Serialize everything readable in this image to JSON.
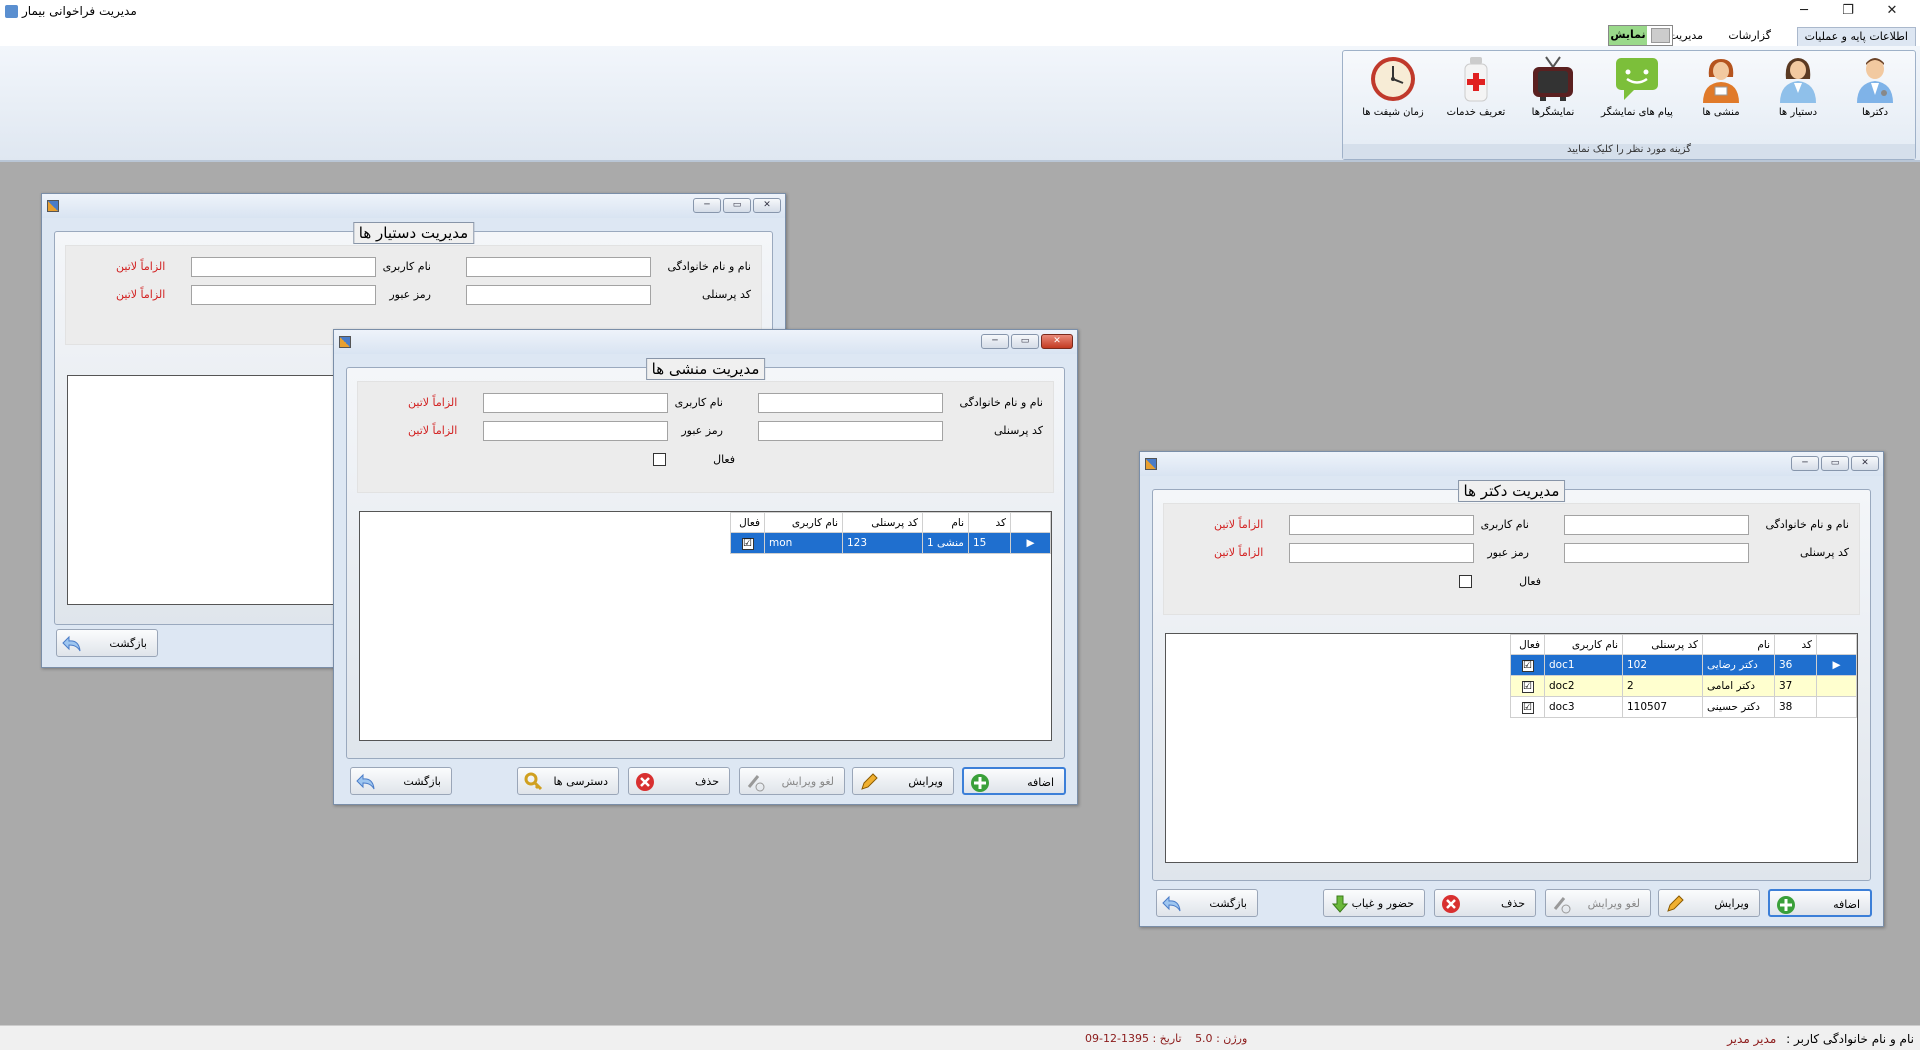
{
  "window": {
    "title": "مدیریت فراخوانی بیمار",
    "minimize": "─",
    "maximize": "❐",
    "close": "✕"
  },
  "menu": {
    "tabs": [
      "اطلاعات پایه و عملیات",
      "گزارشات",
      "مدیریت"
    ],
    "display_toggle": "نمایش"
  },
  "ribbon": {
    "caption": "گزینه مورد نظر را کلیک نمایید",
    "items": [
      {
        "label": "دکترها",
        "icon": "doctor-icon"
      },
      {
        "label": "دستیار ها",
        "icon": "assistant-icon"
      },
      {
        "label": "منشی ها",
        "icon": "secretary-icon"
      },
      {
        "label": "پیام های نمایشگر",
        "icon": "message-icon"
      },
      {
        "label": "نمایشگرها",
        "icon": "tv-icon"
      },
      {
        "label": "تعریف خدمات",
        "icon": "medicine-icon"
      },
      {
        "label": "زمان شیفت ها",
        "icon": "clock-icon"
      }
    ]
  },
  "labels": {
    "fullname": "نام و نام خانوادگی",
    "personnel_code": "کد پرسنلی",
    "username": "نام کاربری",
    "password": "رمز عبور",
    "active": "فعال",
    "required_latin": "الزاماً لاتین"
  },
  "assistants_window": {
    "title": "مدیریت دستیار ها",
    "back": "بازگشت"
  },
  "secretaries_window": {
    "title": "مدیریت منشی ها",
    "columns": [
      "کد",
      "نام",
      "کد پرسنلی",
      "نام کاربری",
      "فعال"
    ],
    "rows": [
      {
        "code": "15",
        "name": "منشی 1",
        "personnel": "123",
        "username": "mon",
        "active": "☑"
      }
    ],
    "buttons": {
      "add": "اضافه",
      "edit": "ویرایش",
      "cancel_edit": "لغو ویرایش",
      "delete": "حذف",
      "access": "دسترسی ها",
      "back": "بازگشت"
    }
  },
  "doctors_window": {
    "title": "مدیریت دکتر ها",
    "columns": [
      "کد",
      "نام",
      "کد پرسنلی",
      "نام کاربری",
      "فعال"
    ],
    "rows": [
      {
        "code": "36",
        "name": "دکتر رضایی",
        "personnel": "102",
        "username": "doc1",
        "active": "☑"
      },
      {
        "code": "37",
        "name": "دکتر امامی",
        "personnel": "2",
        "username": "doc2",
        "active": "☑"
      },
      {
        "code": "38",
        "name": "دکتر حسینی",
        "personnel": "110507",
        "username": "doc3",
        "active": "☑"
      }
    ],
    "buttons": {
      "add": "اضافه",
      "edit": "ویرایش",
      "cancel_edit": "لغو ویرایش",
      "delete": "حذف",
      "attendance": "حضور و غیاب",
      "back": "بازگشت"
    }
  },
  "status": {
    "user_label": "نام و نام خانوادگی کاربر :",
    "user_name": "مدیر مدیر",
    "version_label": "ورژن :",
    "version": "5.0",
    "date_label": "تاریخ :",
    "date": "1395-12-09"
  }
}
